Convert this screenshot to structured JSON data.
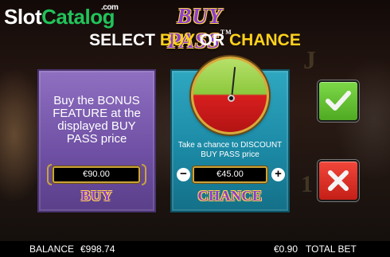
{
  "watermark": {
    "part1": "Slot",
    "part2": "Catalog",
    "suffix": ".com"
  },
  "game_title": {
    "text": "BUY PASS",
    "tm": "TM"
  },
  "prompt": {
    "prefix": "SELECT",
    "option1": "BUY",
    "joiner": "OR",
    "option2": "CHANCE"
  },
  "buy_panel": {
    "description": "Buy the BONUS FEATURE at the displayed BUY PASS price",
    "price": "€90.00",
    "button_label": "BUY"
  },
  "chance_panel": {
    "description": "Take a chance to DISCOUNT BUY PASS price",
    "price": "€45.00",
    "minus_label": "−",
    "plus_label": "+",
    "button_label": "CHANCE"
  },
  "side_buttons": {
    "confirm_icon": "checkmark-icon",
    "cancel_icon": "x-icon"
  },
  "status_bar": {
    "balance_label": "BALANCE",
    "balance_value": "€998.74",
    "bet_value": "€0.90",
    "bet_label": "TOTAL BET"
  },
  "colors": {
    "buy_panel": "#7a5bb0",
    "chance_panel": "#1f8fab",
    "accent_yellow": "#ffd21c",
    "confirm_green": "#5cb82b",
    "cancel_red": "#d92a20"
  }
}
